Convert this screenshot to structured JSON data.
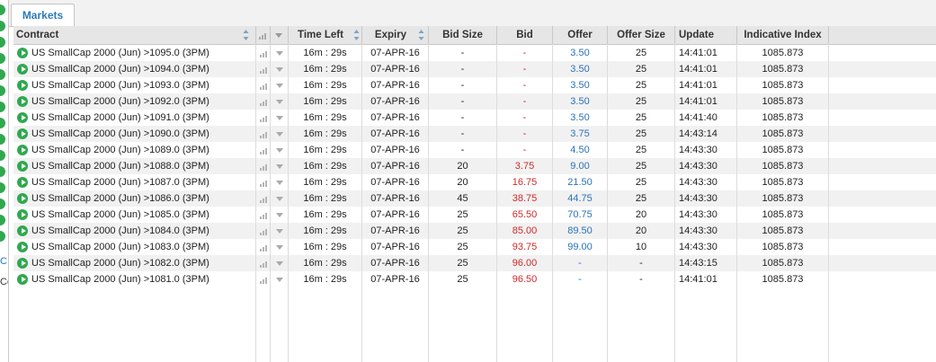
{
  "tabs": [
    {
      "label": "Markets"
    }
  ],
  "left_fragments": [
    "C",
    "Co"
  ],
  "columns": {
    "contract": "Contract",
    "time_left": "Time Left",
    "expiry": "Expiry",
    "bid_size": "Bid Size",
    "bid": "Bid",
    "offer": "Offer",
    "offer_size": "Offer Size",
    "update": "Update",
    "indicative_index": "Indicative Index"
  },
  "icons": {
    "row_status": "play-circle-icon",
    "signal": "signal-bars-icon",
    "menu": "dropdown-arrow-icon",
    "sort": "sort-arrows-icon"
  },
  "colors": {
    "tab_text": "#2a7ab8",
    "status_green": "#2fa84f",
    "bid_red": "#d0292a",
    "offer_blue": "#2a73b8"
  },
  "rows": [
    {
      "contract": "US SmallCap 2000 (Jun) >1095.0 (3PM)",
      "time_left": "16m : 29s",
      "expiry": "07-APR-16",
      "bid_size": "-",
      "bid": "-",
      "offer": "3.50",
      "offer_size": "25",
      "update": "14:41:01",
      "index": "1085.873"
    },
    {
      "contract": "US SmallCap 2000 (Jun) >1094.0 (3PM)",
      "time_left": "16m : 29s",
      "expiry": "07-APR-16",
      "bid_size": "-",
      "bid": "-",
      "offer": "3.50",
      "offer_size": "25",
      "update": "14:41:01",
      "index": "1085.873"
    },
    {
      "contract": "US SmallCap 2000 (Jun) >1093.0 (3PM)",
      "time_left": "16m : 29s",
      "expiry": "07-APR-16",
      "bid_size": "-",
      "bid": "-",
      "offer": "3.50",
      "offer_size": "25",
      "update": "14:41:01",
      "index": "1085.873"
    },
    {
      "contract": "US SmallCap 2000 (Jun) >1092.0 (3PM)",
      "time_left": "16m : 29s",
      "expiry": "07-APR-16",
      "bid_size": "-",
      "bid": "-",
      "offer": "3.50",
      "offer_size": "25",
      "update": "14:41:01",
      "index": "1085.873"
    },
    {
      "contract": "US SmallCap 2000 (Jun) >1091.0 (3PM)",
      "time_left": "16m : 29s",
      "expiry": "07-APR-16",
      "bid_size": "-",
      "bid": "-",
      "offer": "3.50",
      "offer_size": "25",
      "update": "14:41:40",
      "index": "1085.873"
    },
    {
      "contract": "US SmallCap 2000 (Jun) >1090.0 (3PM)",
      "time_left": "16m : 29s",
      "expiry": "07-APR-16",
      "bid_size": "-",
      "bid": "-",
      "offer": "3.75",
      "offer_size": "25",
      "update": "14:43:14",
      "index": "1085.873"
    },
    {
      "contract": "US SmallCap 2000 (Jun) >1089.0 (3PM)",
      "time_left": "16m : 29s",
      "expiry": "07-APR-16",
      "bid_size": "-",
      "bid": "-",
      "offer": "4.50",
      "offer_size": "25",
      "update": "14:43:30",
      "index": "1085.873"
    },
    {
      "contract": "US SmallCap 2000 (Jun) >1088.0 (3PM)",
      "time_left": "16m : 29s",
      "expiry": "07-APR-16",
      "bid_size": "20",
      "bid": "3.75",
      "offer": "9.00",
      "offer_size": "25",
      "update": "14:43:30",
      "index": "1085.873"
    },
    {
      "contract": "US SmallCap 2000 (Jun) >1087.0 (3PM)",
      "time_left": "16m : 29s",
      "expiry": "07-APR-16",
      "bid_size": "20",
      "bid": "16.75",
      "offer": "21.50",
      "offer_size": "25",
      "update": "14:43:30",
      "index": "1085.873"
    },
    {
      "contract": "US SmallCap 2000 (Jun) >1086.0 (3PM)",
      "time_left": "16m : 29s",
      "expiry": "07-APR-16",
      "bid_size": "45",
      "bid": "38.75",
      "offer": "44.75",
      "offer_size": "25",
      "update": "14:43:30",
      "index": "1085.873"
    },
    {
      "contract": "US SmallCap 2000 (Jun) >1085.0 (3PM)",
      "time_left": "16m : 29s",
      "expiry": "07-APR-16",
      "bid_size": "25",
      "bid": "65.50",
      "offer": "70.75",
      "offer_size": "20",
      "update": "14:43:30",
      "index": "1085.873"
    },
    {
      "contract": "US SmallCap 2000 (Jun) >1084.0 (3PM)",
      "time_left": "16m : 29s",
      "expiry": "07-APR-16",
      "bid_size": "25",
      "bid": "85.00",
      "offer": "89.50",
      "offer_size": "20",
      "update": "14:43:30",
      "index": "1085.873"
    },
    {
      "contract": "US SmallCap 2000 (Jun) >1083.0 (3PM)",
      "time_left": "16m : 29s",
      "expiry": "07-APR-16",
      "bid_size": "25",
      "bid": "93.75",
      "offer": "99.00",
      "offer_size": "10",
      "update": "14:43:30",
      "index": "1085.873"
    },
    {
      "contract": "US SmallCap 2000 (Jun) >1082.0 (3PM)",
      "time_left": "16m : 29s",
      "expiry": "07-APR-16",
      "bid_size": "25",
      "bid": "96.00",
      "offer": "-",
      "offer_size": "-",
      "update": "14:43:15",
      "index": "1085.873"
    },
    {
      "contract": "US SmallCap 2000 (Jun) >1081.0 (3PM)",
      "time_left": "16m : 29s",
      "expiry": "07-APR-16",
      "bid_size": "25",
      "bid": "96.50",
      "offer": "-",
      "offer_size": "-",
      "update": "14:41:01",
      "index": "1085.873"
    }
  ]
}
